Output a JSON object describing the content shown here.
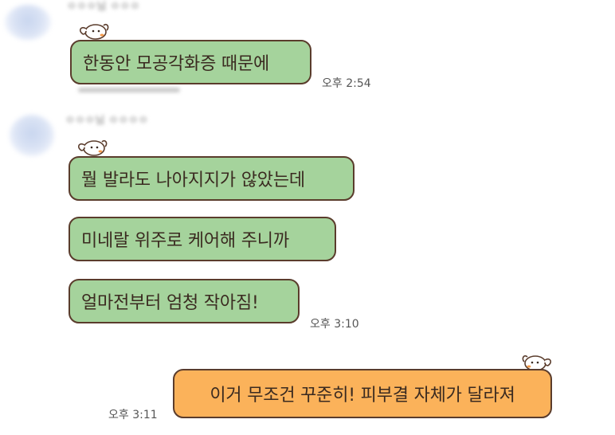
{
  "chat": {
    "messages": [
      {
        "text": "한동안 모공각화증 때문에"
      },
      {
        "text": "뭘 발라도 나아지지가 않았는데"
      },
      {
        "text": "미네랄 위주로 케어해 주니까"
      },
      {
        "text": "얼마전부터 엄청 작아짐!"
      },
      {
        "text": "이거 무조건 꾸준히! 피부결 자체가 달라져"
      }
    ],
    "times": [
      "오후 2:54",
      "오후 3:10",
      "오후 3:11"
    ],
    "senders": [
      "ㅇㅇㅇ님 ㅇㅇㅇ",
      "ㅇㅇㅇ님 ㅇㅇㅇㅇ"
    ]
  },
  "colors": {
    "incoming_bubble": "#a5d39c",
    "outgoing_bubble": "#fbb25a",
    "bubble_border": "#5a3c2c"
  },
  "icons": {
    "bubble_decoration": "puppy-sticker-icon",
    "avatar": "blurred-profile-avatar"
  }
}
